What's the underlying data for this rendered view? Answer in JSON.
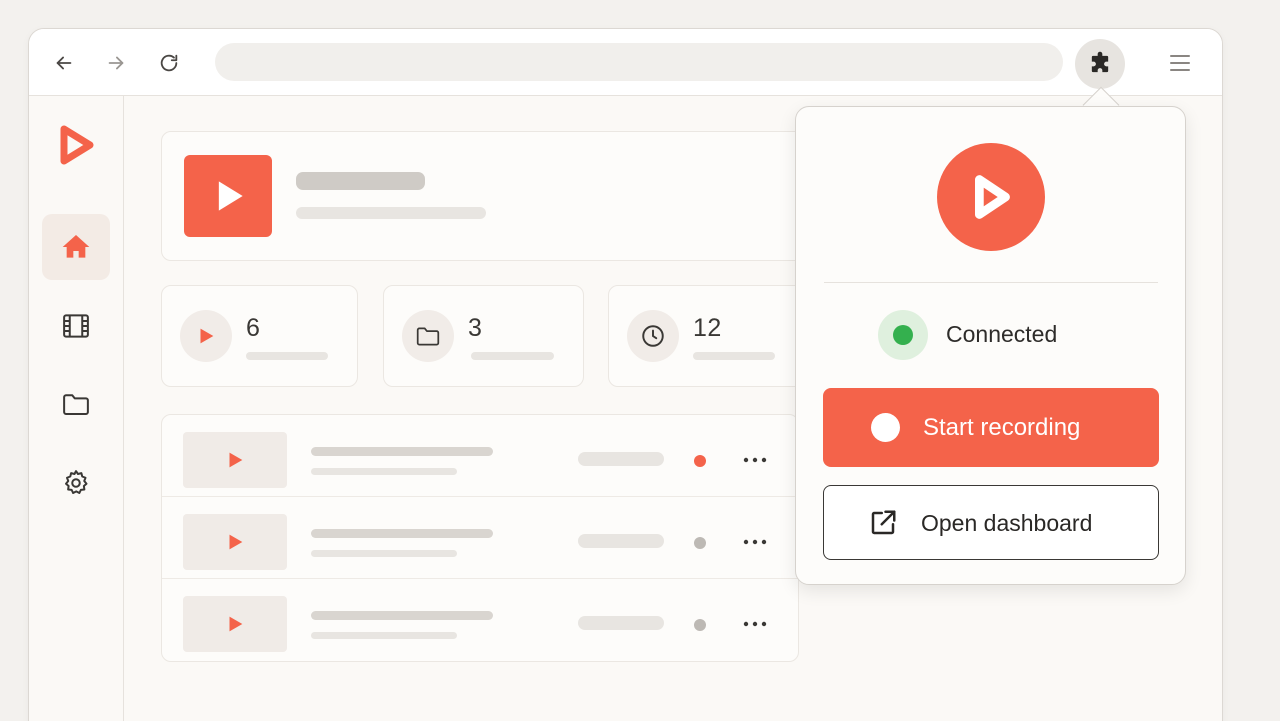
{
  "colors": {
    "accent": "#f4634a",
    "connected": "#34b04e",
    "inactive_dot": "#bdb9b4"
  },
  "toolbar": {
    "back_icon": "arrow-left-icon",
    "forward_icon": "arrow-right-icon",
    "reload_icon": "reload-icon",
    "extension_icon": "puzzle-icon",
    "menu_icon": "hamburger-menu-icon"
  },
  "sidebar": {
    "items": [
      {
        "icon": "home-icon",
        "active": true
      },
      {
        "icon": "film-icon",
        "active": false
      },
      {
        "icon": "folder-icon",
        "active": false
      },
      {
        "icon": "gear-icon",
        "active": false
      }
    ]
  },
  "stats": [
    {
      "icon": "play-icon",
      "value": "6"
    },
    {
      "icon": "folder-icon",
      "value": "3"
    },
    {
      "icon": "clock-icon",
      "value": "12"
    }
  ],
  "recordings": [
    {
      "status": "recording"
    },
    {
      "status": "idle"
    },
    {
      "status": "idle"
    }
  ],
  "popup": {
    "status_text": "Connected",
    "record_label": "Start recording",
    "dashboard_label": "Open dashboard"
  }
}
